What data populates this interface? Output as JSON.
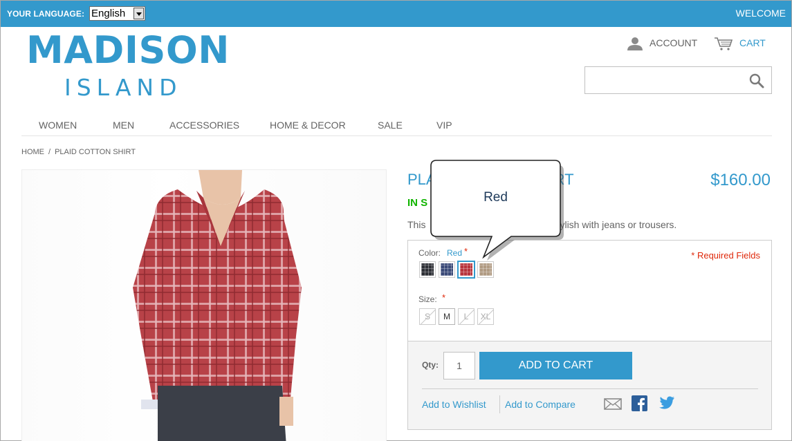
{
  "topbar": {
    "language_label": "YOUR LANGUAGE:",
    "language_value": "English",
    "welcome": "WELCOME"
  },
  "logo": {
    "main": "MADISON",
    "sub": "ISLAND"
  },
  "header": {
    "account_label": "ACCOUNT",
    "cart_label": "CART",
    "search_value": ""
  },
  "nav": {
    "items": [
      {
        "label": "WOMEN"
      },
      {
        "label": "MEN"
      },
      {
        "label": "ACCESSORIES"
      },
      {
        "label": "HOME & DECOR"
      },
      {
        "label": "SALE"
      },
      {
        "label": "VIP"
      }
    ]
  },
  "breadcrumb": {
    "home": "HOME",
    "separator": "/",
    "current": "PLAID COTTON SHIRT"
  },
  "product": {
    "name_visible_start": "PLA",
    "name_visible_end": "RT",
    "price": "$160.00",
    "stock_visible": "IN S",
    "desc_start": "This",
    "desc_end": "ylish with jeans or trousers."
  },
  "options": {
    "color_label": "Color:",
    "color_value": "Red",
    "required_star": "*",
    "required_text": "* Required Fields",
    "swatches": [
      {
        "name": "Charcoal",
        "color": "#2e3036"
      },
      {
        "name": "Blue",
        "color": "#3b4a78"
      },
      {
        "name": "Red",
        "color": "#b7343c",
        "selected": true
      },
      {
        "name": "Khaki",
        "color": "#b09a82"
      }
    ],
    "size_label": "Size:",
    "sizes": [
      {
        "label": "S",
        "available": false
      },
      {
        "label": "M",
        "available": true
      },
      {
        "label": "L",
        "available": false
      },
      {
        "label": "XL",
        "available": false
      }
    ]
  },
  "cart": {
    "qty_label": "Qty:",
    "qty_value": "1",
    "add_button": "ADD TO CART",
    "wishlist": "Add to Wishlist",
    "compare": "Add to Compare"
  },
  "tooltip": {
    "text": "Red"
  },
  "colors": {
    "brand": "#3399cc",
    "stock": "#11b400",
    "required": "#df280a"
  }
}
